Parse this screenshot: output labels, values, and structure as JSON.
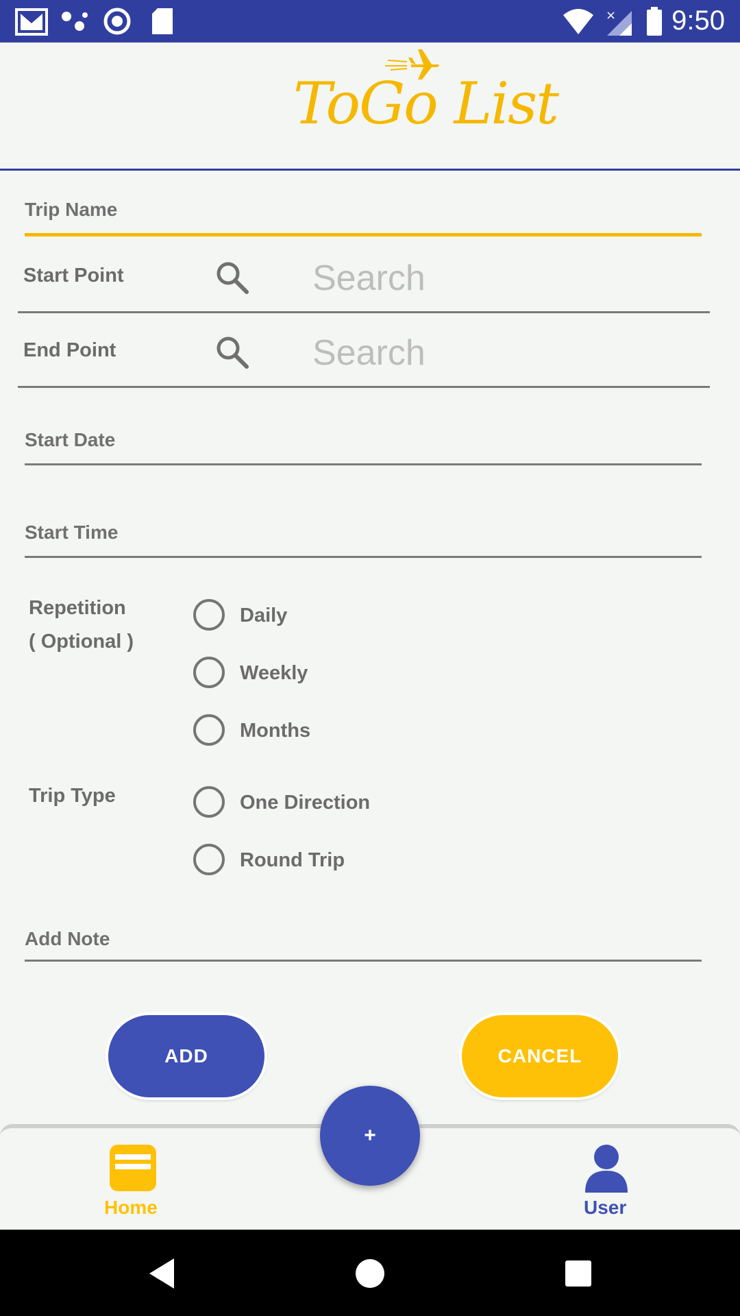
{
  "colors": {
    "primary": "#303f9f",
    "accent": "#ffc107",
    "add": "#3f51b5",
    "text": "#6b6b6b"
  },
  "status_bar": {
    "time": "9:50",
    "left_icons": [
      "gmail-icon",
      "dots-icon",
      "circle-record-icon",
      "sd-card-icon"
    ],
    "right_icons": [
      "wifi-icon",
      "no-signal-icon",
      "battery-icon"
    ]
  },
  "header": {
    "logo_text": "ToGo List",
    "logo_icon": "airplane-icon"
  },
  "form": {
    "trip_name_placeholder": "Trip Name",
    "start_point_label": "Start Point",
    "start_point_search": "Search",
    "end_point_label": "End Point",
    "end_point_search": "Search",
    "start_date_placeholder": "Start Date",
    "start_time_placeholder": "Start Time",
    "repetition_label": "Repetition",
    "repetition_optional": "( Optional )",
    "repetition_options": [
      "Daily",
      "Weekly",
      "Months"
    ],
    "trip_type_label": "Trip Type",
    "trip_type_options": [
      "One Direction",
      "Round Trip"
    ],
    "note_placeholder": "Add Note"
  },
  "buttons": {
    "add": "ADD",
    "cancel": "CANCEL",
    "fab": "+"
  },
  "bottom_nav": {
    "home": "Home",
    "user": "User"
  }
}
